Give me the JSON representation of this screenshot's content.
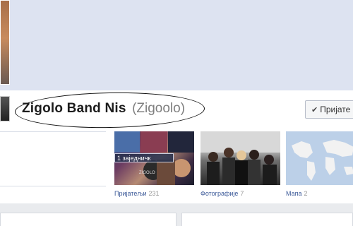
{
  "page": {
    "name": "Zigolo Band Nis",
    "username": "(Zigoolo)"
  },
  "actions": {
    "add_friend": "Пријате",
    "check_icon": "check-icon"
  },
  "tiles": {
    "friends_overlay": "1 заједничк",
    "friends_label": "Пријатељи",
    "friends_count": "231",
    "photos_label": "Фотографије",
    "photos_count": "7",
    "map_label": "Мапа",
    "map_count": "2"
  },
  "colors": {
    "link": "#3b5998",
    "cover": "#dde3f1",
    "background": "#e9ebee"
  }
}
